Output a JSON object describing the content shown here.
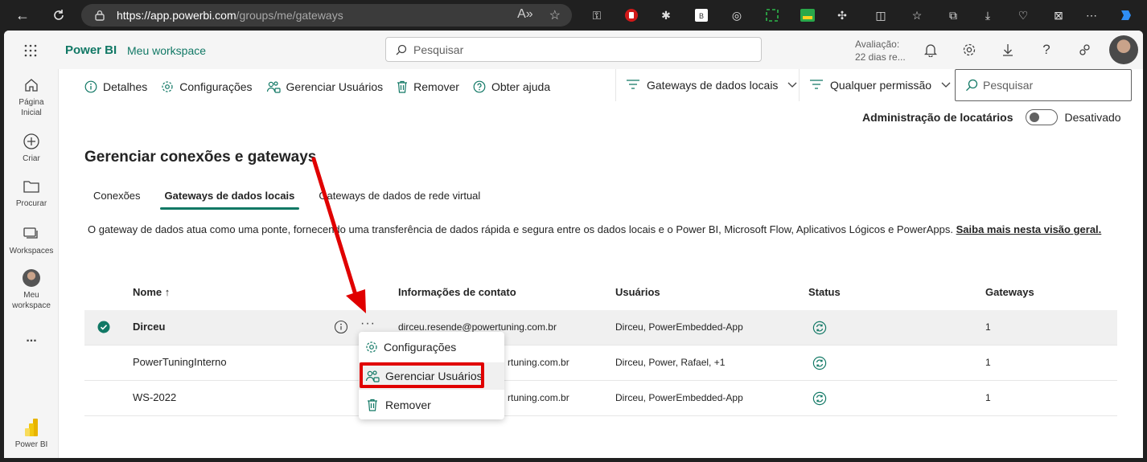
{
  "browser": {
    "url_host": "https://app.powerbi.com",
    "url_path": "/groups/me/gateways"
  },
  "topbar": {
    "brand": "Power BI",
    "workspace": "Meu workspace",
    "search_placeholder": "Pesquisar",
    "trial_line1": "Avaliação:",
    "trial_line2": "22 dias re..."
  },
  "leftnav": {
    "items": [
      {
        "label_line1": "Página",
        "label_line2": "Inicial"
      },
      {
        "label_line1": "Criar",
        "label_line2": ""
      },
      {
        "label_line1": "Procurar",
        "label_line2": ""
      },
      {
        "label_line1": "Workspaces",
        "label_line2": ""
      },
      {
        "label_line1": "Meu",
        "label_line2": "workspace"
      },
      {
        "label_line1": "...",
        "label_line2": ""
      }
    ],
    "footer_label": "Power BI"
  },
  "actions": {
    "details": "Detalhes",
    "settings": "Configurações",
    "manage_users": "Gerenciar Usuários",
    "remove": "Remover",
    "help": "Obter ajuda"
  },
  "filters": {
    "gateway_type": "Gateways de dados locais",
    "permission": "Qualquer permissão",
    "search_placeholder": "Pesquisar"
  },
  "tenant_admin": {
    "label": "Administração de locatários",
    "state": "Desativado"
  },
  "page": {
    "title": "Gerenciar conexões e gateways",
    "tabs": [
      {
        "label": "Conexões",
        "active": false
      },
      {
        "label": "Gateways de dados locais",
        "active": true
      },
      {
        "label": "Gateways de dados de rede virtual",
        "active": false
      }
    ],
    "description": "O gateway de dados atua como uma ponte, fornecendo uma transferência de dados rápida e segura entre os dados locais e o Power BI, Microsoft Flow, Aplicativos Lógicos e PowerApps. ",
    "learn_more": "Saiba mais nesta visão geral."
  },
  "table": {
    "headers": {
      "name": "Nome ↑",
      "contact": "Informações de contato",
      "users": "Usuários",
      "status": "Status",
      "gateways": "Gateways"
    },
    "rows": [
      {
        "name": "Dirceu",
        "contact": "dirceu.resende@powertuning.com.br",
        "users": "Dirceu, PowerEmbedded-App",
        "gateways": "1"
      },
      {
        "name": "PowerTuningInterno",
        "contact": "rtuning.com.br",
        "users": "Dirceu, Power, Rafael, +1",
        "gateways": "1"
      },
      {
        "name": "WS-2022",
        "contact": "rtuning.com.br",
        "users": "Dirceu, PowerEmbedded-App",
        "gateways": "1"
      }
    ]
  },
  "context_menu": {
    "items": [
      {
        "label": "Configurações"
      },
      {
        "label": "Gerenciar Usuários"
      },
      {
        "label": "Remover"
      }
    ]
  },
  "colors": {
    "accent": "#117865",
    "annotation": "#e00000",
    "status": "#117865"
  }
}
